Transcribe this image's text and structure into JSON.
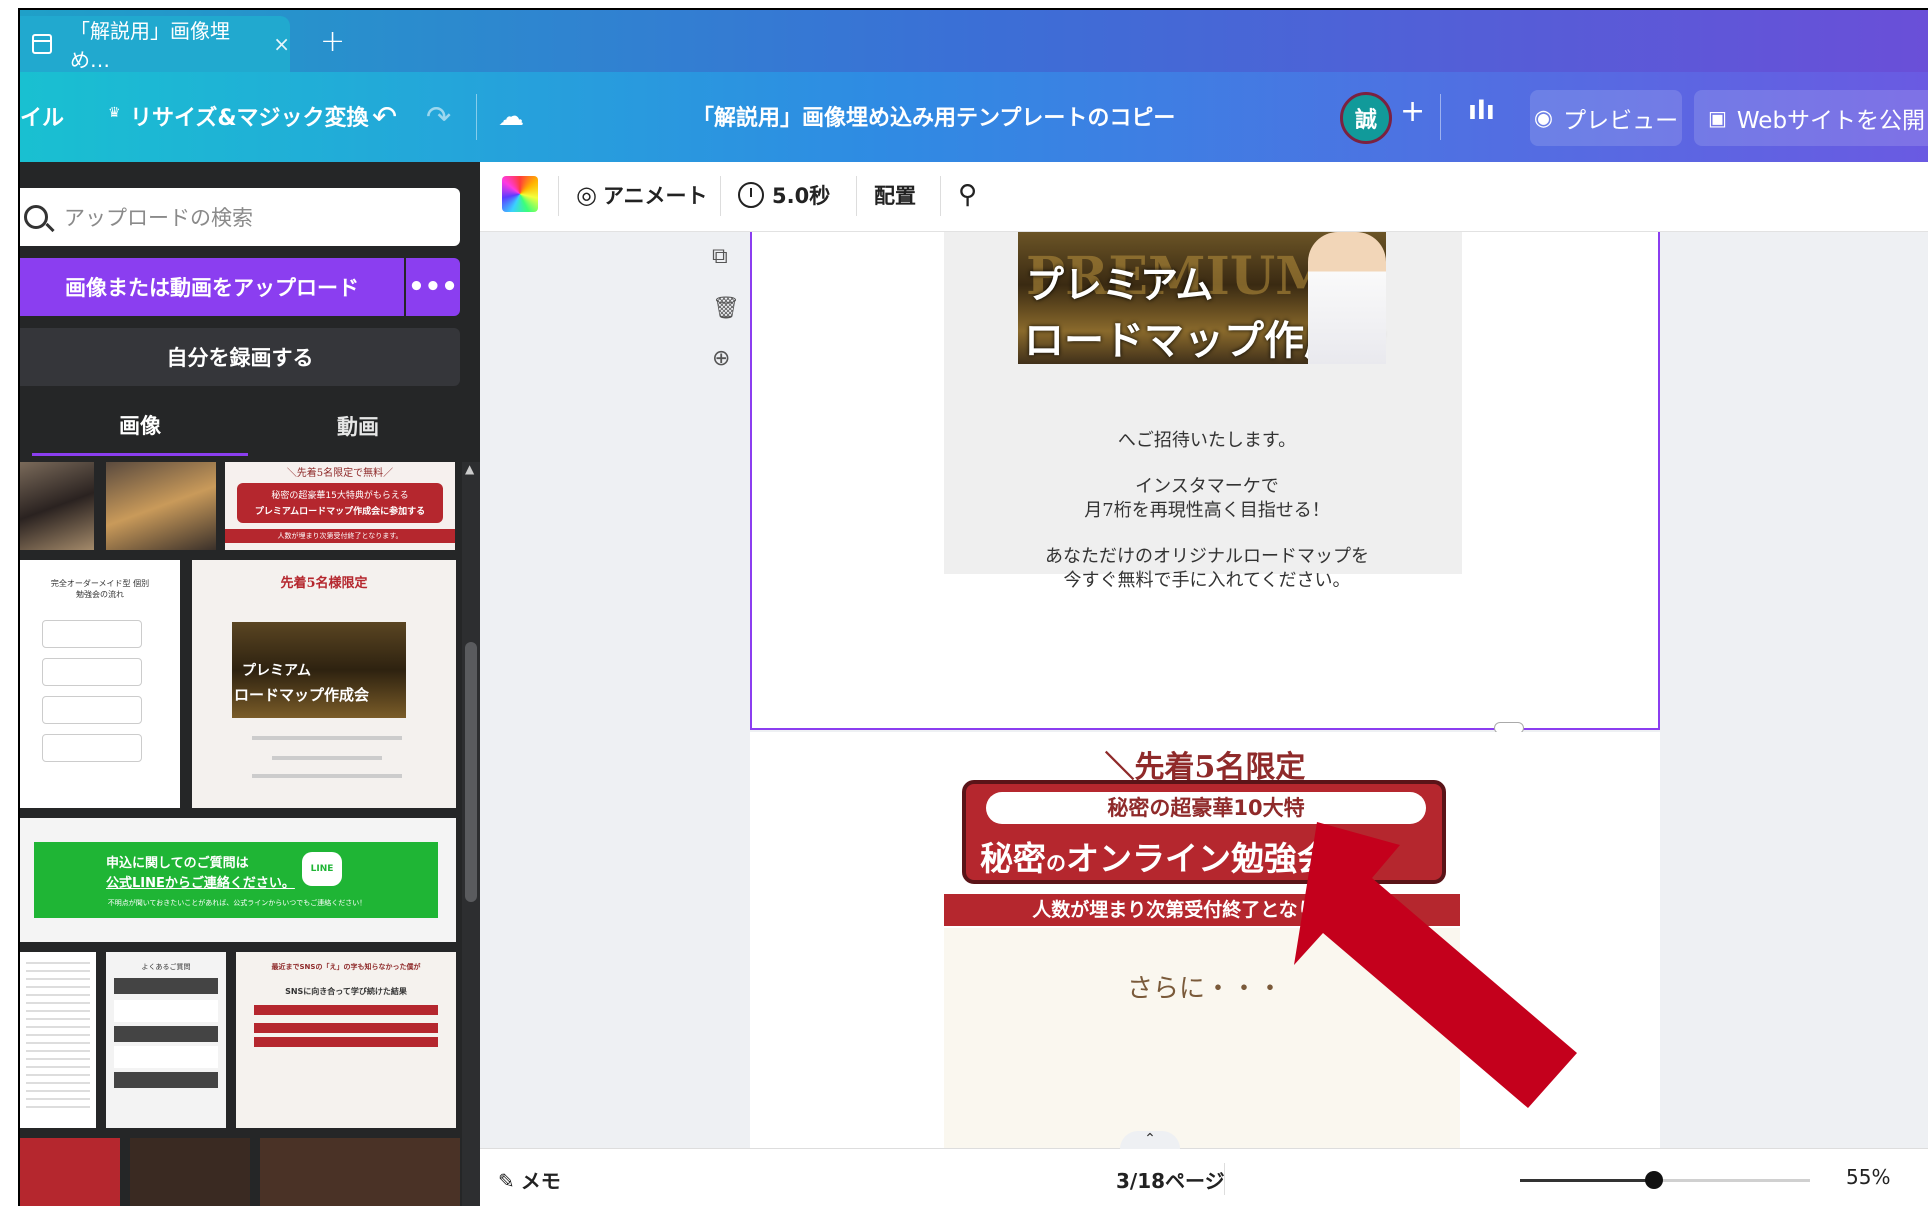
{
  "browser_tab": {
    "title": "「解説用」画像埋め…",
    "close": "×",
    "new_tab": "+"
  },
  "header": {
    "file_label": "イル",
    "resize_label": "リサイズ&マジック変換",
    "crown": "♛",
    "undo": "↶",
    "redo": "↷",
    "cloud_icon": "☁",
    "doc_title": "「解説用」画像埋め込み用テンプレートのコピー",
    "avatar": "誠",
    "add": "+",
    "stats": "ılı",
    "preview": "プレビュー",
    "publish": "Webサイトを公開"
  },
  "left_panel": {
    "search_placeholder": "アップロードの検索",
    "upload_button": "画像または動画をアップロード",
    "more": "•••",
    "record_button": "自分を録画する",
    "tabs": [
      {
        "label": "画像"
      },
      {
        "label": "動画"
      }
    ],
    "thumb_texts": {
      "t1_head": "＼先着5名限定で無料／",
      "t1_red": "秘密の超豪華15大特典がもらえる",
      "t1_red2": "プレミアムロードマップ作成会に参加する",
      "t1_foot": "人数が埋まり次第受付終了となります。",
      "t2_title": "完全オーダーメイド型 個別勉強会の流れ",
      "t3_title": "先着5名様限定",
      "t3_line": "プレミアム",
      "t3_line2": "ロードマップ作成会",
      "line_q1": "申込に関してのご質問は",
      "line_q2": "公式LINEからご連絡ください。",
      "line_badge": "LINE",
      "line_small": "不明点が聞いておきたいことがあれば、公式ラインからいつでもご連絡ください！",
      "t4_title": "よくあるご質問",
      "t5_title": "最近までSNSの「え」の字も知らなかった僕が",
      "t5_sub": "SNSに向き合って学び続けた結果"
    }
  },
  "toolbar": {
    "animate": "アニメート",
    "duration": "5.0秒",
    "position": "配置"
  },
  "canvas": {
    "banner_line1": "プレミアム",
    "banner_line2": "ロードマップ作成会",
    "banner_bg": "PREMIUM",
    "invite_lines": [
      "へご招待いたします。",
      "インスタマーケで",
      "月7桁を再現性高く目指せる！",
      "あなただけのオリジナルロードマップを",
      "今すぐ無料で手に入れてください。"
    ],
    "page2_head": "＼先着5名限定",
    "page2_pill": "秘密の超豪華10大特",
    "page2_big_a": "秘密",
    "page2_big_no": "の",
    "page2_big_b": "オンライン勉強会",
    "page2_bar": "人数が埋まり次第受付終了となります。",
    "page2_sara": "さらに・・・"
  },
  "footer": {
    "notes": "メモ",
    "page_indicator": "3/18ページ",
    "zoom": "55%",
    "zoom_fraction": 0.55
  },
  "colors": {
    "accent": "#8b3ef0",
    "red": "#b5272e",
    "line_green": "#1fb535"
  }
}
